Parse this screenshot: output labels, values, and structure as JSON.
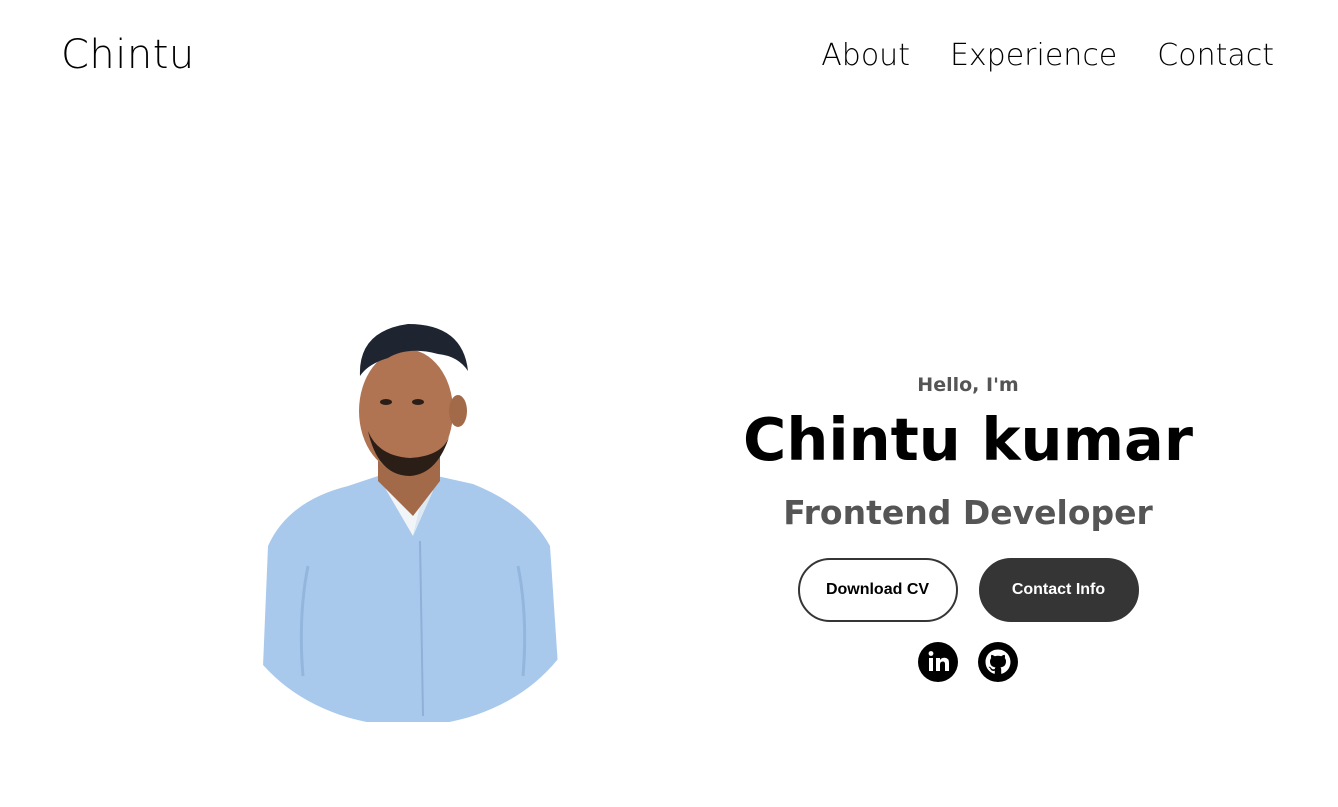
{
  "header": {
    "logo": "Chintu",
    "nav": [
      {
        "label": "About"
      },
      {
        "label": "Experience"
      },
      {
        "label": "Contact"
      }
    ]
  },
  "hero": {
    "greeting": "Hello, I'm",
    "name": "Chintu kumar",
    "role": "Frontend Developer",
    "buttons": {
      "download_cv": "Download CV",
      "contact_info": "Contact Info"
    },
    "socials": [
      {
        "icon": "linkedin-icon"
      },
      {
        "icon": "github-icon"
      }
    ]
  },
  "colors": {
    "accent_dark": "#353535",
    "muted_text": "#555555",
    "background": "#ffffff"
  }
}
